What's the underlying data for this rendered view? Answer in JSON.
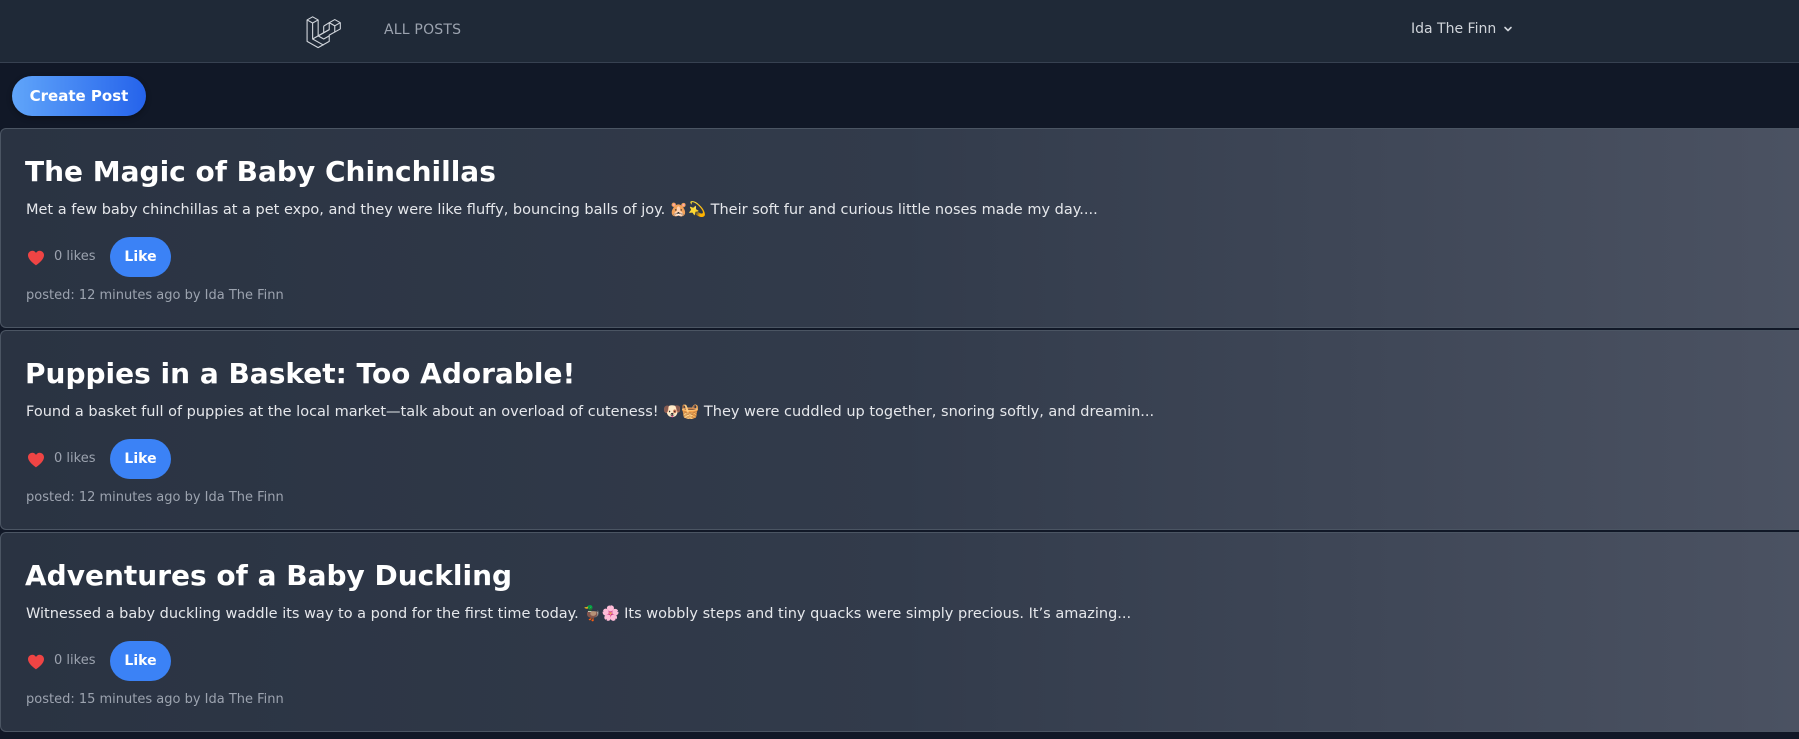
{
  "nav": {
    "logo_icon": "laravel-logo-icon",
    "all_posts": "ALL POSTS",
    "user_name": "Ida The Finn",
    "user_menu_icon": "chevron-down-icon"
  },
  "actions": {
    "create_post": "Create Post"
  },
  "posts": [
    {
      "title": "The Magic of Baby Chinchillas",
      "excerpt": "Met a few baby chinchillas at a pet expo, and they were like fluffy, bouncing balls of joy. 🐹💫 Their soft fur and curious little noses made my day....",
      "likes": "0 likes",
      "like_label": "Like",
      "meta": "posted: 12 minutes ago by Ida The Finn"
    },
    {
      "title": "Puppies in a Basket: Too Adorable!",
      "excerpt": "Found a basket full of puppies at the local market—talk about an overload of cuteness! 🐶🧺 They were cuddled up together, snoring softly, and dreamin...",
      "likes": "0 likes",
      "like_label": "Like",
      "meta": "posted: 12 minutes ago by Ida The Finn"
    },
    {
      "title": "Adventures of a Baby Duckling",
      "excerpt": "Witnessed a baby duckling waddle its way to a pond for the first time today. 🦆🌸 Its wobbly steps and tiny quacks were simply precious. It’s amazing...",
      "likes": "0 likes",
      "like_label": "Like",
      "meta": "posted: 15 minutes ago by Ida The Finn"
    }
  ],
  "colors": {
    "background": "#111827",
    "nav_background": "#1f2937",
    "accent": "#3b82f6",
    "heart": "#ef4444"
  }
}
